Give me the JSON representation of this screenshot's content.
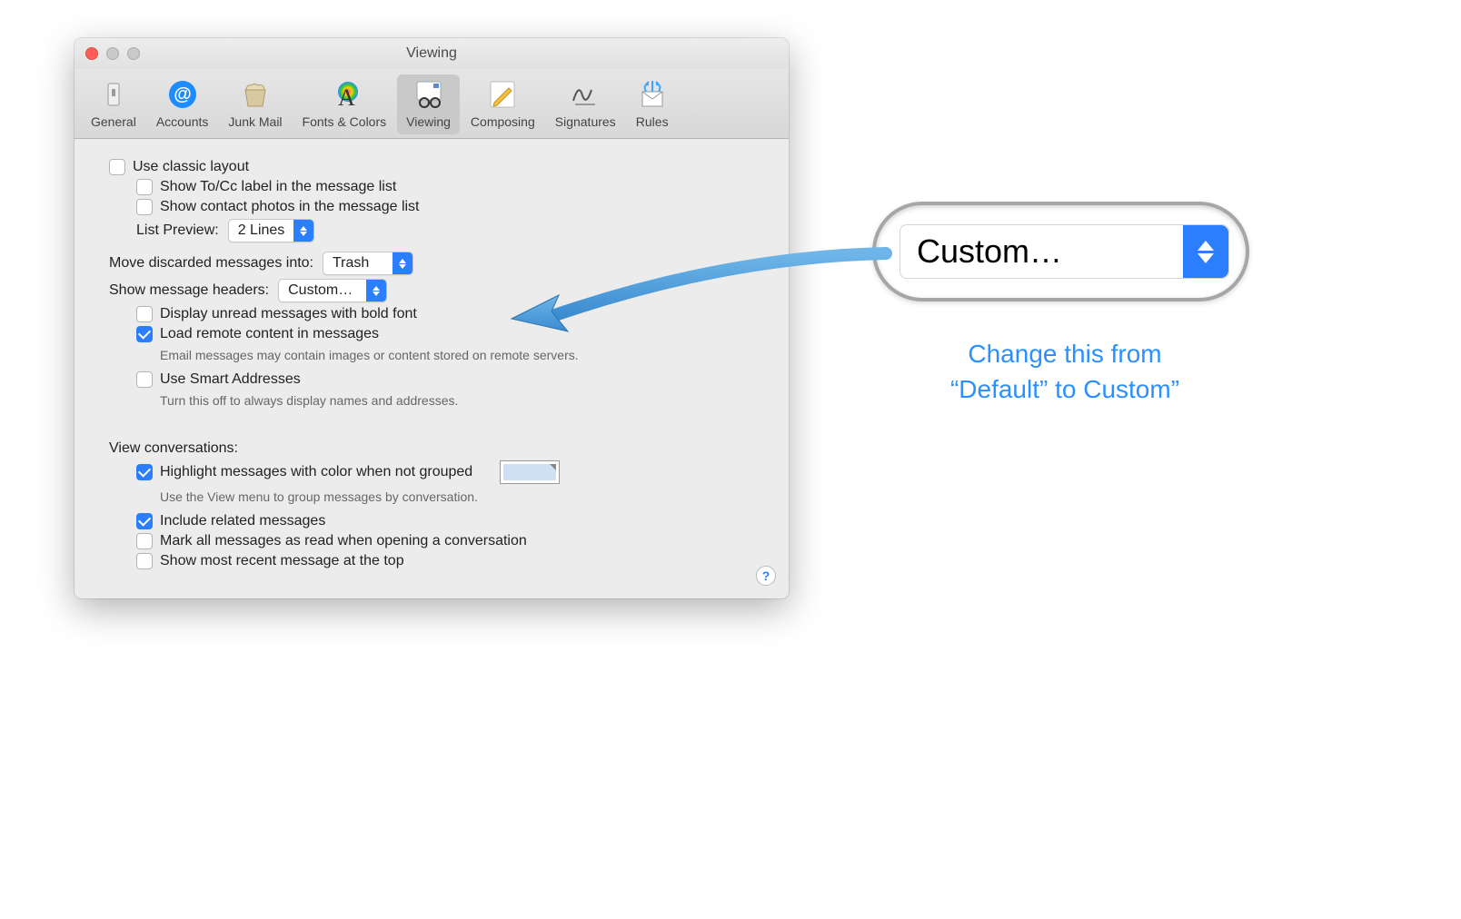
{
  "window": {
    "title": "Viewing"
  },
  "toolbar": {
    "items": [
      {
        "label": "General"
      },
      {
        "label": "Accounts"
      },
      {
        "label": "Junk Mail"
      },
      {
        "label": "Fonts & Colors"
      },
      {
        "label": "Viewing"
      },
      {
        "label": "Composing"
      },
      {
        "label": "Signatures"
      },
      {
        "label": "Rules"
      }
    ]
  },
  "options": {
    "classic_layout": "Use classic layout",
    "show_tocc": "Show To/Cc label in the message list",
    "show_photos": "Show contact photos in the message list",
    "list_preview_label": "List Preview:",
    "list_preview_value": "2 Lines",
    "move_discarded_label": "Move discarded messages into:",
    "move_discarded_value": "Trash",
    "show_headers_label": "Show message headers:",
    "show_headers_value": "Custom…",
    "display_unread_bold": "Display unread messages with bold font",
    "load_remote": "Load remote content in messages",
    "load_remote_sub": "Email messages may contain images or content stored on remote servers.",
    "use_smart": "Use Smart Addresses",
    "use_smart_sub": "Turn this off to always display names and addresses.",
    "conversations_header": "View conversations:",
    "highlight": "Highlight messages with color when not grouped",
    "highlight_sub": "Use the View menu to group messages by conversation.",
    "include_related": "Include related messages",
    "mark_read": "Mark all messages as read when opening a conversation",
    "recent_top": "Show most recent message at the top"
  },
  "callout": {
    "value": "Custom…",
    "text1": "Change this from",
    "text2": "“Default” to Custom”"
  }
}
